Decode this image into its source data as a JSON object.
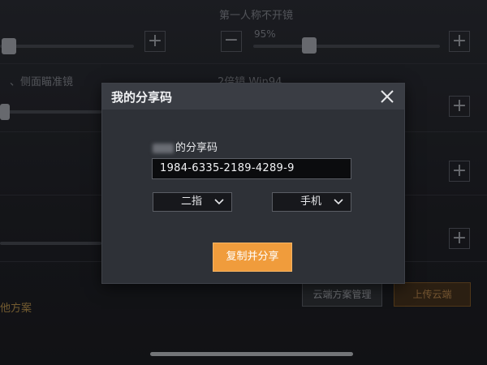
{
  "background": {
    "top_label": "第一人称不开镜",
    "percent": "95%",
    "left_label": "、侧面瞄准镜",
    "scope_label": "2倍镜 Win94",
    "left_bottom_label": "他方案",
    "cloud_manage_label": "云端方案管理",
    "upload_cloud_label": "上传云端"
  },
  "modal": {
    "title": "我的分享码",
    "share_code_label": "的分享码",
    "share_code_value": "1984-6335-2189-4289-9",
    "finger_select": "二指",
    "device_select": "手机",
    "share_button_label": "复制并分享"
  },
  "colors": {
    "accent": "#f09c3c",
    "modal_bg": "#2e3137",
    "header_bg": "#3a3d44"
  }
}
